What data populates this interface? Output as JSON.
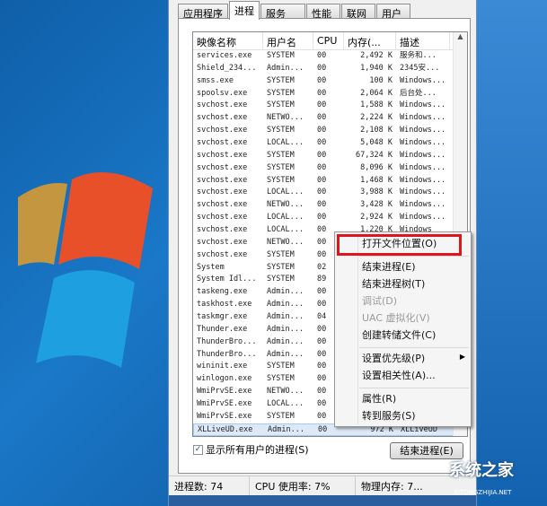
{
  "tabs": [
    "应用程序",
    "进程",
    "服务",
    "性能",
    "联网",
    "用户"
  ],
  "columns": [
    "映像名称",
    "用户名",
    "CPU",
    "内存(...",
    "描述"
  ],
  "processes": [
    [
      "services.exe",
      "SYSTEM",
      "00",
      "2,492 K",
      "服务和..."
    ],
    [
      "Shield_234...",
      "Admin...",
      "00",
      "1,940 K",
      "2345安..."
    ],
    [
      "smss.exe",
      "SYSTEM",
      "00",
      "100 K",
      "Windows..."
    ],
    [
      "spoolsv.exe",
      "SYSTEM",
      "00",
      "2,064 K",
      "后台处..."
    ],
    [
      "svchost.exe",
      "SYSTEM",
      "00",
      "1,588 K",
      "Windows..."
    ],
    [
      "svchost.exe",
      "NETWO...",
      "00",
      "2,224 K",
      "Windows..."
    ],
    [
      "svchost.exe",
      "SYSTEM",
      "00",
      "2,108 K",
      "Windows..."
    ],
    [
      "svchost.exe",
      "LOCAL...",
      "00",
      "5,048 K",
      "Windows..."
    ],
    [
      "svchost.exe",
      "SYSTEM",
      "00",
      "67,324 K",
      "Windows..."
    ],
    [
      "svchost.exe",
      "SYSTEM",
      "00",
      "8,096 K",
      "Windows..."
    ],
    [
      "svchost.exe",
      "SYSTEM",
      "00",
      "1,468 K",
      "Windows..."
    ],
    [
      "svchost.exe",
      "LOCAL...",
      "00",
      "3,988 K",
      "Windows..."
    ],
    [
      "svchost.exe",
      "NETWO...",
      "00",
      "3,428 K",
      "Windows..."
    ],
    [
      "svchost.exe",
      "LOCAL...",
      "00",
      "2,924 K",
      "Windows..."
    ],
    [
      "svchost.exe",
      "LOCAL...",
      "00",
      "1,220 K",
      "Windows"
    ],
    [
      "svchost.exe",
      "NETWO...",
      "00",
      "",
      ""
    ],
    [
      "svchost.exe",
      "SYSTEM",
      "00",
      "",
      ""
    ],
    [
      "System",
      "SYSTEM",
      "02",
      "",
      ""
    ],
    [
      "System Idl...",
      "SYSTEM",
      "89",
      "",
      ""
    ],
    [
      "taskeng.exe",
      "Admin...",
      "00",
      "",
      ""
    ],
    [
      "taskhost.exe",
      "Admin...",
      "00",
      "",
      ""
    ],
    [
      "taskmgr.exe",
      "Admin...",
      "04",
      "",
      ""
    ],
    [
      "Thunder.exe",
      "Admin...",
      "00",
      "",
      ""
    ],
    [
      "ThunderBro...",
      "Admin...",
      "00",
      "",
      ""
    ],
    [
      "ThunderBro...",
      "Admin...",
      "00",
      "",
      ""
    ],
    [
      "wininit.exe",
      "SYSTEM",
      "00",
      "",
      ""
    ],
    [
      "winlogon.exe",
      "SYSTEM",
      "00",
      "",
      ""
    ],
    [
      "WmiPrvSE.exe",
      "NETWO...",
      "00",
      "",
      ""
    ],
    [
      "WmiPrvSE.exe",
      "LOCAL...",
      "00",
      "",
      ""
    ],
    [
      "WmiPrvSE.exe",
      "SYSTEM",
      "00",
      "",
      ""
    ],
    [
      "XLLiveUD.exe",
      "Admin...",
      "00",
      "972 K",
      "XLLiveUD"
    ]
  ],
  "show_all_label": "显示所有用户的进程(S)",
  "end_process_button": "结束进程(E)",
  "status": {
    "count": "进程数: 74",
    "cpu": "CPU 使用率: 7%",
    "mem": "物理内存: 7..."
  },
  "menu": {
    "open_location": "打开文件位置(O)",
    "end_process": "结束进程(E)",
    "end_tree": "结束进程树(T)",
    "debug": "调试(D)",
    "uac": "UAC 虚拟化(V)",
    "dump": "创建转储文件(C)",
    "priority": "设置优先级(P)",
    "affinity": "设置相关性(A)...",
    "properties": "属性(R)",
    "goto_service": "转到服务(S)"
  },
  "watermark": "系统之家",
  "watermark_url": "XITONGZHIJIA.NET"
}
